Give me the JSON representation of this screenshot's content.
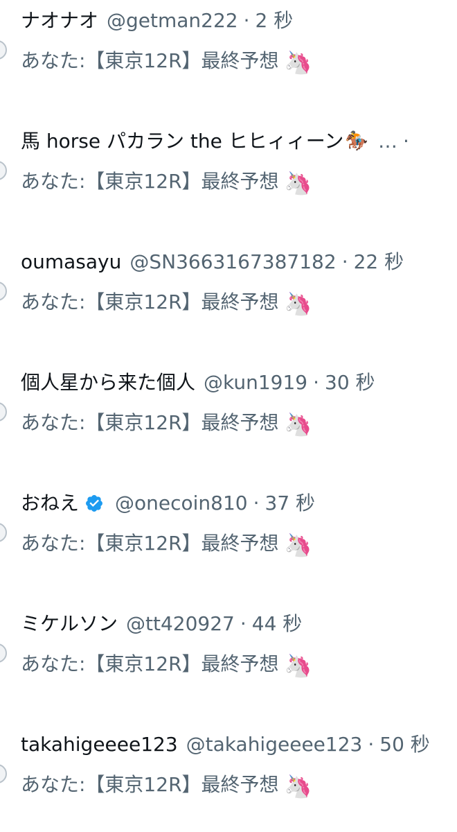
{
  "notifications": [
    {
      "name": "ナオナオ",
      "verified": false,
      "handle": "@getman222",
      "separator": "·",
      "time": "2 秒",
      "snippet": "あなた:【東京12R】最終予想",
      "emoji": "🦄"
    },
    {
      "name": "馬 horse パカラン the ヒヒィィーン",
      "emoji_after_name": "🏇",
      "truncated_marker": "…",
      "separator": "·",
      "verified": false,
      "snippet": "あなた:【東京12R】最終予想",
      "emoji": "🦄"
    },
    {
      "name": "oumasayu",
      "verified": false,
      "handle": "@SN3663167387182",
      "separator": "·",
      "time": "22 秒",
      "snippet": "あなた:【東京12R】最終予想",
      "emoji": "🦄"
    },
    {
      "name": "個人星から来た個人",
      "verified": false,
      "handle": "@kun1919",
      "separator": "·",
      "time": "30 秒",
      "snippet": "あなた:【東京12R】最終予想",
      "emoji": "🦄"
    },
    {
      "name": "おねえ",
      "verified": true,
      "handle": "@onecoin810",
      "separator": "·",
      "time": "37 秒",
      "snippet": "あなた:【東京12R】最終予想",
      "emoji": "🦄"
    },
    {
      "name": "ミケルソン",
      "verified": false,
      "handle": "@tt420927",
      "separator": "·",
      "time": "44 秒",
      "snippet": "あなた:【東京12R】最終予想",
      "emoji": "🦄"
    },
    {
      "name": "takahigeeee123",
      "verified": false,
      "handle": "@takahigeeee123",
      "separator": "·",
      "time": "50 秒",
      "snippet": "あなた:【東京12R】最終予想",
      "emoji": "🦄"
    }
  ],
  "colors": {
    "name": "#0f1419",
    "meta": "#536471",
    "verified_badge": "#1d9bf0",
    "avatar_edge": "#b9c2ca"
  },
  "icons": {
    "verified": "verified-badge-icon",
    "unicorn": "unicorn-emoji",
    "horse": "horse-racing-emoji"
  }
}
